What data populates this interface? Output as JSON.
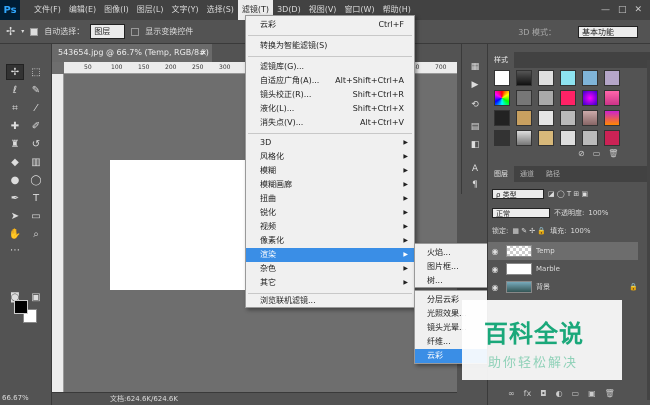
{
  "app": {
    "logo": "Ps"
  },
  "menubar": {
    "items": [
      "文件(F)",
      "编辑(E)",
      "图像(I)",
      "图层(L)",
      "文字(Y)",
      "选择(S)",
      "滤镜(T)",
      "3D(D)",
      "视图(V)",
      "窗口(W)",
      "帮助(H)"
    ],
    "window_buttons": [
      "—",
      "□",
      "✕"
    ]
  },
  "options": {
    "auto_select_label": "自动选择：",
    "auto_select_value": "图层",
    "show_transform_label": "显示变换控件",
    "mode_3d_label": "3D 模式：",
    "workspace_value": "基本功能"
  },
  "document": {
    "tab_title": "543654.jpg @ 66.7% (Temp, RGB/8#) *",
    "close": "×",
    "ruler_ticks": [
      "50",
      "100",
      "150",
      "200",
      "250",
      "300",
      "350",
      "400",
      "450",
      "500",
      "550",
      "600",
      "650",
      "700"
    ]
  },
  "status": {
    "zoom": "66.67%",
    "doc_info": "文档:624.6K/624.6K"
  },
  "filter_menu": {
    "items": [
      {
        "label": "云彩",
        "shortcut": "Ctrl+F"
      },
      {
        "label": "转换为智能滤镜(S)",
        "shortcut": ""
      },
      {
        "label": "滤镜库(G)...",
        "shortcut": ""
      },
      {
        "label": "自适应广角(A)...",
        "shortcut": "Alt+Shift+Ctrl+A"
      },
      {
        "label": "镜头校正(R)...",
        "shortcut": "Shift+Ctrl+R"
      },
      {
        "label": "液化(L)...",
        "shortcut": "Shift+Ctrl+X"
      },
      {
        "label": "消失点(V)...",
        "shortcut": "Alt+Ctrl+V"
      },
      {
        "label": "3D",
        "shortcut": ""
      },
      {
        "label": "风格化",
        "shortcut": ""
      },
      {
        "label": "模糊",
        "shortcut": ""
      },
      {
        "label": "模糊画廊",
        "shortcut": ""
      },
      {
        "label": "扭曲",
        "shortcut": ""
      },
      {
        "label": "锐化",
        "shortcut": ""
      },
      {
        "label": "视频",
        "shortcut": ""
      },
      {
        "label": "像素化",
        "shortcut": ""
      },
      {
        "label": "渲染",
        "shortcut": ""
      },
      {
        "label": "杂色",
        "shortcut": ""
      },
      {
        "label": "其它",
        "shortcut": ""
      },
      {
        "label": "浏览联机滤镜...",
        "shortcut": ""
      }
    ]
  },
  "render_submenu": {
    "items": [
      "火焰...",
      "图片框...",
      "树..."
    ]
  },
  "render_submenu2": {
    "items": [
      "分层云彩",
      "光照效果...",
      "镜头光晕...",
      "纤维...",
      "云彩"
    ]
  },
  "styles_panel": {
    "tab": "样式"
  },
  "layers_panel": {
    "tabs": [
      "图层",
      "通道",
      "路径"
    ],
    "kind_label": "ρ 类型",
    "blend_mode": "正常",
    "opacity_label": "不透明度:",
    "opacity_value": "100%",
    "lock_label": "锁定:",
    "fill_label": "填充:",
    "fill_value": "100%",
    "layers": [
      {
        "name": "Temp"
      },
      {
        "name": "Marble"
      },
      {
        "name": "背景"
      }
    ],
    "footer_icons": [
      "∞",
      "fx",
      "◘",
      "◐",
      "▭",
      "▣",
      "🗑"
    ]
  },
  "watermark": {
    "title": "百科全说",
    "subtitle": "助你轻松解决"
  },
  "colors": {
    "menu_highlight": "#3a8ee6",
    "watermark": "#1aa87a"
  }
}
